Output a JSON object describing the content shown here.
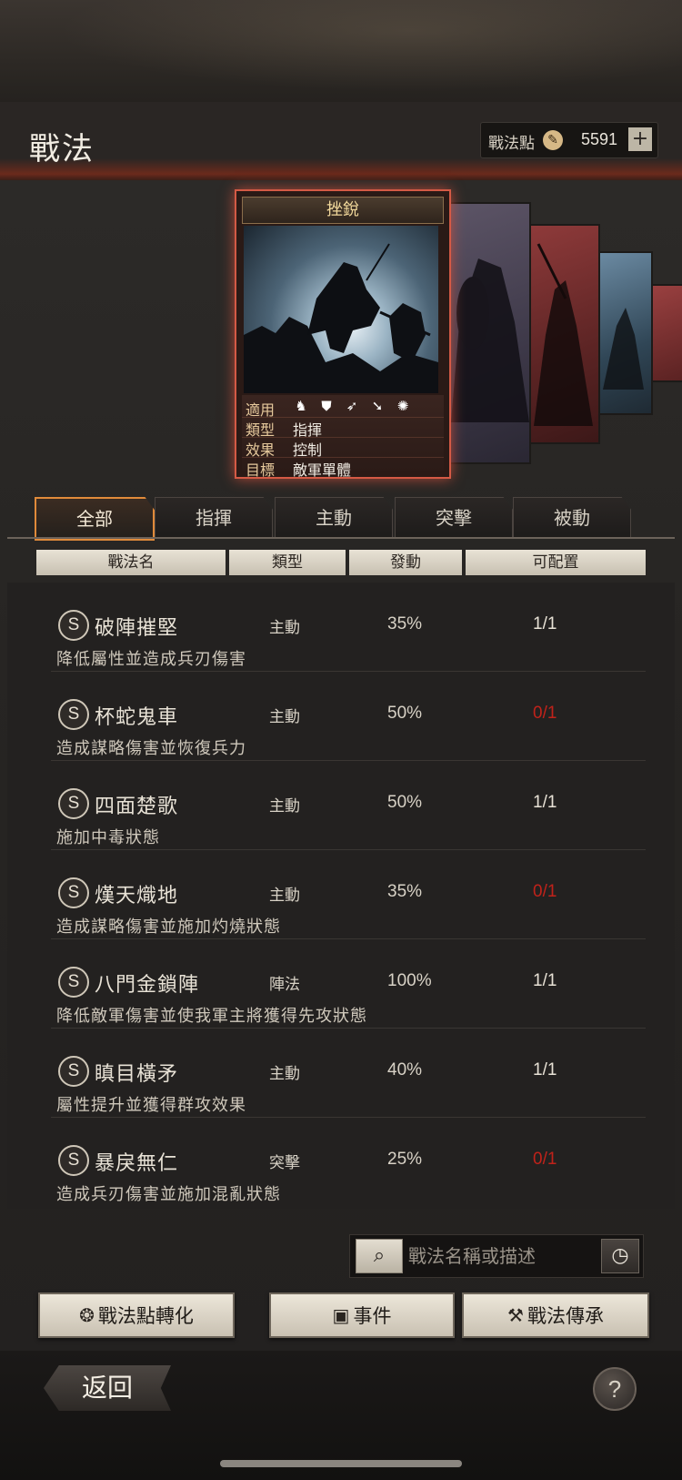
{
  "header": {
    "title": "戰法",
    "points_label": "戰法點",
    "points_value": "5591",
    "plus_label": "+"
  },
  "card": {
    "name": "挫銳",
    "info": [
      {
        "label": "適用",
        "value": ""
      },
      {
        "label": "類型",
        "value": "指揮"
      },
      {
        "label": "效果",
        "value": "控制"
      },
      {
        "label": "目標",
        "value": "敵軍單體"
      }
    ],
    "applicable_icons": [
      "cavalry-icon",
      "shield-icon",
      "bow-icon",
      "spear-icon",
      "wheel-icon"
    ]
  },
  "tabs": [
    {
      "label": "全部",
      "active": true
    },
    {
      "label": "指揮",
      "active": false
    },
    {
      "label": "主動",
      "active": false
    },
    {
      "label": "突擊",
      "active": false
    },
    {
      "label": "被動",
      "active": false
    }
  ],
  "columns": [
    "戰法名",
    "類型",
    "發動",
    "可配置"
  ],
  "skills": [
    {
      "badge": "S",
      "name": "破陣摧堅",
      "type": "主動",
      "rate": "35%",
      "avail": "1/1",
      "avail_color": "#e8e2d6",
      "desc": "降低屬性並造成兵刃傷害"
    },
    {
      "badge": "S",
      "name": "杯蛇鬼車",
      "type": "主動",
      "rate": "50%",
      "avail": "0/1",
      "avail_color": "#c0221a",
      "desc": "造成謀略傷害並恢復兵力"
    },
    {
      "badge": "S",
      "name": "四面楚歌",
      "type": "主動",
      "rate": "50%",
      "avail": "1/1",
      "avail_color": "#e8e2d6",
      "desc": "施加中毒狀態"
    },
    {
      "badge": "S",
      "name": "熯天熾地",
      "type": "主動",
      "rate": "35%",
      "avail": "0/1",
      "avail_color": "#c0221a",
      "desc": "造成謀略傷害並施加灼燒狀態"
    },
    {
      "badge": "S",
      "name": "八門金鎖陣",
      "type": "陣法",
      "rate": "100%",
      "avail": "1/1",
      "avail_color": "#e8e2d6",
      "desc": "降低敵軍傷害並使我軍主將獲得先攻狀態"
    },
    {
      "badge": "S",
      "name": "瞋目橫矛",
      "type": "主動",
      "rate": "40%",
      "avail": "1/1",
      "avail_color": "#e8e2d6",
      "desc": "屬性提升並獲得群攻效果"
    },
    {
      "badge": "S",
      "name": "暴戾無仁",
      "type": "突擊",
      "rate": "25%",
      "avail": "0/1",
      "avail_color": "#c0221a",
      "desc": "造成兵刃傷害並施加混亂狀態"
    }
  ],
  "search": {
    "placeholder": "戰法名稱或描述"
  },
  "actions": {
    "convert_label": "戰法點轉化",
    "events_label": "事件",
    "inherit_label": "戰法傳承"
  },
  "footer": {
    "back_label": "返回",
    "help_label": "?"
  }
}
